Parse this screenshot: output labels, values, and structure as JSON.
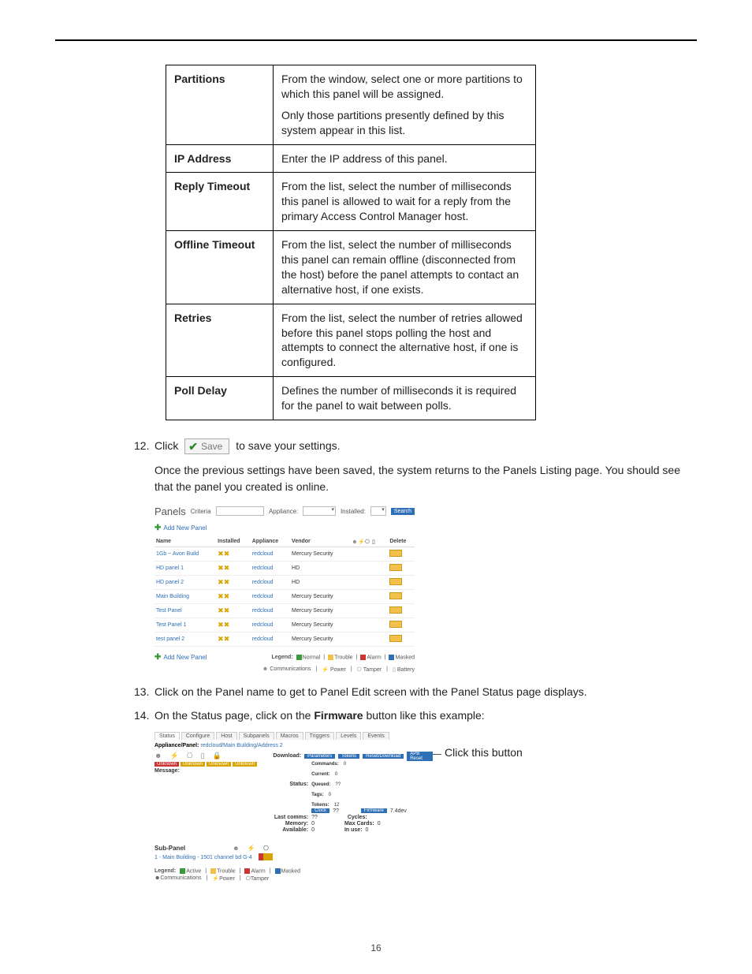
{
  "rows": [
    {
      "label": "Partitions",
      "paras": [
        "From the window, select one or more partitions to which this panel will be assigned.",
        "Only those partitions presently defined by this system appear in this list."
      ]
    },
    {
      "label": "IP Address",
      "paras": [
        "Enter the IP address of this panel."
      ]
    },
    {
      "label": "Reply Timeout",
      "paras": [
        "From the list, select the number of milliseconds this panel is allowed to wait for a reply from the primary Access Control Manager host."
      ]
    },
    {
      "label": "Offline Timeout",
      "paras": [
        "From the list, select the number of milliseconds this panel can remain offline (disconnected from the host) before the panel attempts to contact an alternative host, if one exists."
      ]
    },
    {
      "label": "Retries",
      "paras": [
        "From the list, select the number of retries allowed before this panel stops polling the host and attempts to connect the alternative host, if one is configured."
      ]
    },
    {
      "label": "Poll Delay",
      "paras": [
        "Defines the number of milliseconds it is required for the panel to wait between polls."
      ]
    }
  ],
  "step12": {
    "num": "12.",
    "prefix": "Click",
    "saveLabel": "Save",
    "suffix": "to save your settings."
  },
  "afterSave": "Once the previous settings have been saved, the system returns to the Panels Listing page. You should see that the panel you created is online.",
  "panelsListing": {
    "title": "Panels",
    "criteriaLabel": "Criteria",
    "applianceLabel": "Appliance:",
    "installedLabel": "Installed:",
    "searchBtn": "Search",
    "addNew": "Add New Panel",
    "cols": {
      "name": "Name",
      "installed": "Installed",
      "appliance": "Appliance",
      "vendor": "Vendor",
      "delete": "Delete"
    },
    "rows": [
      {
        "name": "1Gb ~ Avon Build",
        "appliance": "redcloud",
        "vendor": "Mercury Security"
      },
      {
        "name": "HD panel 1",
        "appliance": "redcloud",
        "vendor": "HD"
      },
      {
        "name": "HD panel 2",
        "appliance": "redcloud",
        "vendor": "HD"
      },
      {
        "name": "Main Building",
        "appliance": "redcloud",
        "vendor": "Mercury Security"
      },
      {
        "name": "Test Panel",
        "appliance": "redcloud",
        "vendor": "Mercury Security"
      },
      {
        "name": "Test Panel 1",
        "appliance": "redcloud",
        "vendor": "Mercury Security"
      },
      {
        "name": "test panel 2",
        "appliance": "redcloud",
        "vendor": "Mercury Security"
      }
    ],
    "legend": {
      "label": "Legend:",
      "normal": "Normal",
      "trouble": "Trouble",
      "alarm": "Alarm",
      "masked": "Masked"
    },
    "legend2": {
      "comm": "Communications",
      "power": "Power",
      "tamper": "Tamper",
      "battery": "Battery"
    }
  },
  "step13": {
    "num": "13.",
    "text": "Click on the Panel name to get to Panel Edit screen with the Panel Status page displays."
  },
  "step14": {
    "num": "14.",
    "prefix": "On the Status page, click on the ",
    "bold": "Firmware",
    "suffix": " button like this example:"
  },
  "statusShot": {
    "tabs": [
      "Status",
      "Configure",
      "Host",
      "Subpanels",
      "Macros",
      "Triggers",
      "Levels",
      "Events"
    ],
    "breadcrumbLabel": "Appliance/Panel:",
    "breadcrumbLinks": [
      "redcloud",
      "Main Building",
      "Address 2"
    ],
    "statusChips": [
      "Unknown",
      "Unknown",
      "Unknown",
      "Unknown"
    ],
    "messageLabel": "Message:",
    "download": {
      "label": "Download:",
      "buttons": [
        "Parameters",
        "Tokens",
        "Reset/Download",
        "APB Reset"
      ]
    },
    "statusLine": {
      "label": "Status:",
      "items": [
        [
          "Commands:",
          "0"
        ],
        [
          "Current:",
          "0"
        ],
        [
          "Queued:",
          "??"
        ],
        [
          "Tags:",
          "0"
        ],
        [
          "Tokens:",
          "12"
        ]
      ]
    },
    "clockBtn": "Clock",
    "firmwareBtn": "Firmware",
    "timeVal": "??",
    "firmwareVal": "7.4dev",
    "kv": [
      [
        "Last comms:",
        "??"
      ],
      [
        "Cycles:",
        ""
      ],
      [
        "Memory:",
        "0"
      ],
      [
        "Max Cards:",
        "0"
      ],
      [
        "Available:",
        "0"
      ],
      [
        "In use:",
        "0"
      ]
    ],
    "subpanel": {
      "title": "Sub-Panel",
      "row": "1 - Main Building - 1501 channel bd G-4"
    },
    "legend": {
      "label": "Legend:",
      "active": "Active",
      "trouble": "Trouble",
      "alarm": "Alarm",
      "masked": "Masked"
    },
    "legend2": {
      "comm": "Communications",
      "power": "Power",
      "tamper": "Tamper"
    },
    "callout": "Click this button"
  },
  "pageNumber": "16"
}
